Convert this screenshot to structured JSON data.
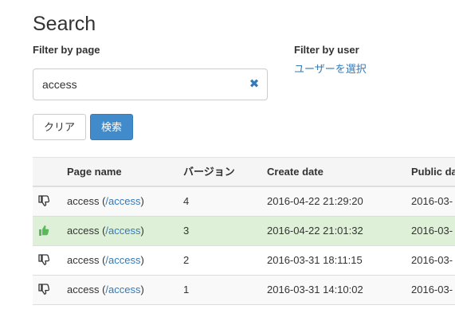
{
  "page": {
    "title": "Search"
  },
  "filters": {
    "page_label": "Filter by page",
    "user_label": "Filter by user",
    "user_link": "ユーザーを選択",
    "search_value": "access",
    "search_placeholder": ""
  },
  "buttons": {
    "clear": "クリア",
    "search": "検索"
  },
  "table": {
    "headers": {
      "name": "Page name",
      "version": "バージョン",
      "create_date": "Create date",
      "public_date": "Public date"
    },
    "rows": [
      {
        "icon": "thumbs-down-icon",
        "name": "access",
        "open": " (",
        "path": "/access",
        "close": ")",
        "version": "4",
        "create_date": "2016-04-22 21:29:20",
        "public_date": "2016-03-"
      },
      {
        "icon": "thumbs-up-icon",
        "name": "access",
        "open": " (",
        "path": "/access",
        "close": ")",
        "version": "3",
        "create_date": "2016-04-22 21:01:32",
        "public_date": "2016-03-"
      },
      {
        "icon": "thumbs-down-icon",
        "name": "access",
        "open": " (",
        "path": "/access",
        "close": ")",
        "version": "2",
        "create_date": "2016-03-31 18:11:15",
        "public_date": "2016-03-"
      },
      {
        "icon": "thumbs-down-icon",
        "name": "access",
        "open": " (",
        "path": "/access",
        "close": ")",
        "version": "1",
        "create_date": "2016-03-31 14:10:02",
        "public_date": "2016-03-"
      }
    ]
  },
  "colors": {
    "accent": "#337ab7",
    "primary_button": "#428bca",
    "active_row": "#dff0d8",
    "thumbs_up": "#5cb85c",
    "thumbs_down": "#333333"
  }
}
